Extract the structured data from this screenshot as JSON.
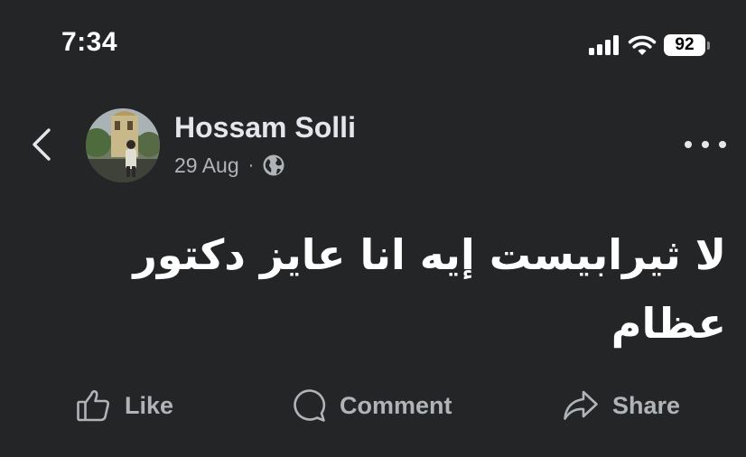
{
  "status_bar": {
    "time": "7:34",
    "battery_level": "92",
    "signal_icon": "cellular-signal-icon",
    "wifi_icon": "wifi-icon"
  },
  "post": {
    "author": "Hossam Solli",
    "date": "29 Aug",
    "separator": "·",
    "privacy_icon": "globe-icon",
    "text": "لا ثيرابيست إيه انا عايز دكتور عظام"
  },
  "actions": {
    "like_label": "Like",
    "comment_label": "Comment",
    "share_label": "Share"
  },
  "colors": {
    "background": "#242526",
    "primary_text": "#e4e6eb",
    "secondary_text": "#b0b3b8"
  }
}
